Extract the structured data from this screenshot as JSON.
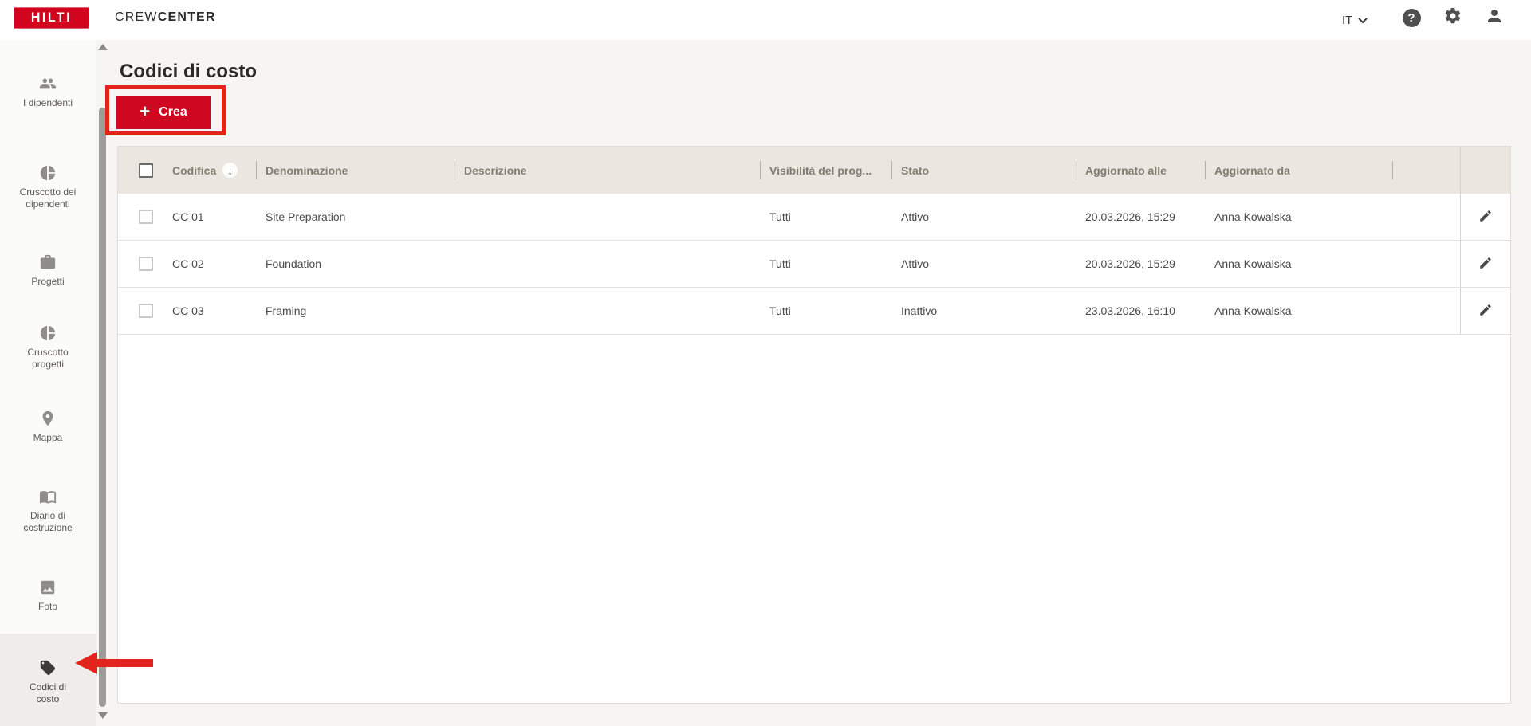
{
  "topbar": {
    "logo_text": "HILTI",
    "brand": {
      "light": "CREW",
      "bold": "CENTER"
    },
    "language": "IT",
    "help_glyph": "?"
  },
  "sidebar": {
    "items": [
      {
        "icon": "people-icon",
        "line1": "I dipendenti",
        "line2": "",
        "active": false
      },
      {
        "icon": "pie-chart-icon",
        "line1": "Cruscotto dei",
        "line2": "dipendenti",
        "active": false
      },
      {
        "icon": "briefcase-icon",
        "line1": "Progetti",
        "line2": "",
        "active": false
      },
      {
        "icon": "pie-chart-icon",
        "line1": "Cruscotto",
        "line2": "progetti",
        "active": false
      },
      {
        "icon": "map-pin-icon",
        "line1": "Mappa",
        "line2": "",
        "active": false
      },
      {
        "icon": "book-icon",
        "line1": "Diario di",
        "line2": "costruzione",
        "active": false
      },
      {
        "icon": "photo-icon",
        "line1": "Foto",
        "line2": "",
        "active": false
      },
      {
        "icon": "tag-icon",
        "line1": "Codici di",
        "line2": "costo",
        "active": true
      }
    ]
  },
  "page": {
    "title": "Codici di costo",
    "create_button": {
      "plus": "+",
      "label": "Crea"
    }
  },
  "table": {
    "columns": [
      {
        "label": "Codifica",
        "sort": "desc",
        "sort_glyph": "↓"
      },
      {
        "label": "Denominazione"
      },
      {
        "label": "Descrizione"
      },
      {
        "label": "Visibilità del prog..."
      },
      {
        "label": "Stato"
      },
      {
        "label": "Aggiornato alle"
      },
      {
        "label": "Aggiornato da"
      }
    ],
    "rows": [
      {
        "codifica": "CC 01",
        "denominazione": "Site Preparation",
        "descrizione": "",
        "visibilita": "Tutti",
        "stato": "Attivo",
        "aggiornato_alle": "20.03.2026, 15:29",
        "aggiornato_da": "Anna Kowalska"
      },
      {
        "codifica": "CC 02",
        "denominazione": "Foundation",
        "descrizione": "",
        "visibilita": "Tutti",
        "stato": "Attivo",
        "aggiornato_alle": "20.03.2026, 15:29",
        "aggiornato_da": "Anna Kowalska"
      },
      {
        "codifica": "CC 03",
        "denominazione": "Framing",
        "descrizione": "",
        "visibilita": "Tutti",
        "stato": "Inattivo",
        "aggiornato_alle": "23.03.2026, 16:10",
        "aggiornato_da": "Anna Kowalska"
      }
    ]
  },
  "colors": {
    "hilti_red": "#d2051e",
    "button_red": "#ce0820",
    "annotation_red": "#e2241c",
    "table_header_bg": "#ebe7e0",
    "table_header_text": "#837c70",
    "page_bg": "#f6f5f3",
    "cell_text": "#4a4a4a"
  }
}
